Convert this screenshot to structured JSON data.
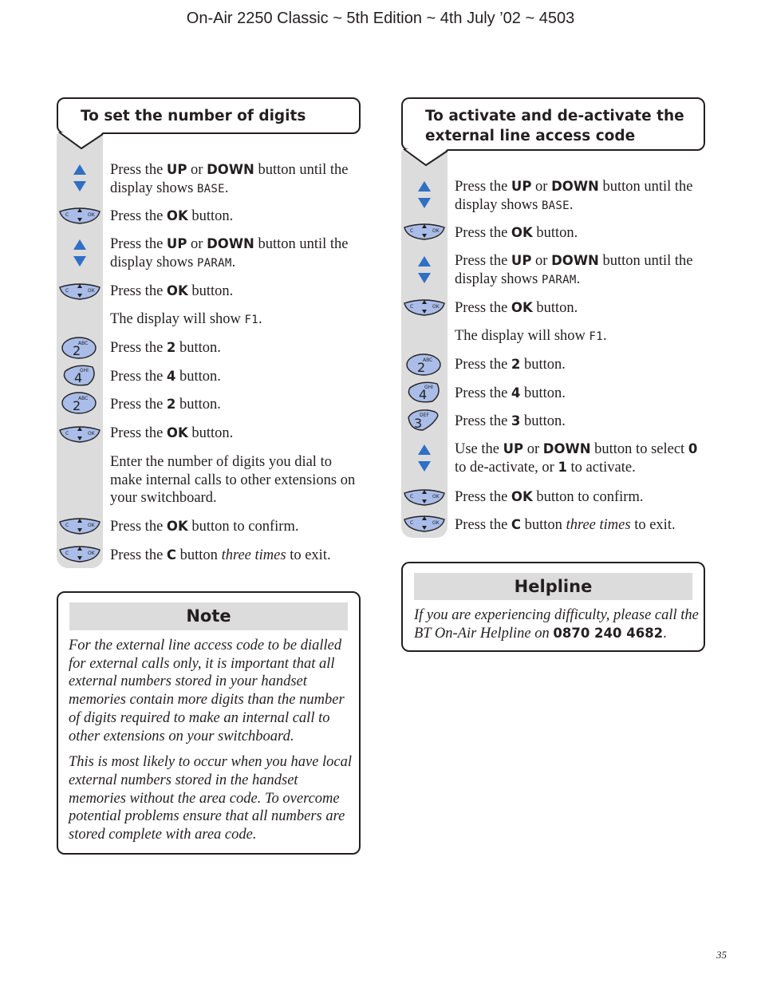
{
  "header": {
    "title": "On-Air 2250 Classic ~ 5th Edition ~ 4th July ’02 ~ 4503"
  },
  "page_number": "35",
  "left_section": {
    "title": "To set the number of digits",
    "steps": [
      {
        "icon": "up-down-arrows",
        "pre": "Press the ",
        "b1": "UP",
        "mid": " or ",
        "b2": "DOWN",
        "post": " button until the display shows ",
        "lcd": "BASE",
        "end": "."
      },
      {
        "icon": "ok-nav-key",
        "pre": "Press the ",
        "b1": "OK",
        "post": " button."
      },
      {
        "icon": "up-down-arrows",
        "pre": "Press the ",
        "b1": "UP",
        "mid": " or ",
        "b2": "DOWN",
        "post": " button until the display shows ",
        "lcd": "PARAM",
        "end": "."
      },
      {
        "icon": "ok-nav-key",
        "pre": "Press the ",
        "b1": "OK",
        "post": " button."
      },
      {
        "icon": "none",
        "pre": "The display will show ",
        "lcd": "F1",
        "end": "."
      },
      {
        "icon": "key-2",
        "key_digit": "2",
        "key_letters": "ABC",
        "pre": "Press the ",
        "b1": "2",
        "post": " button."
      },
      {
        "icon": "key-4",
        "key_digit": "4",
        "key_letters": "GHI",
        "pre": "Press the ",
        "b1": "4",
        "post": " button."
      },
      {
        "icon": "key-2",
        "key_digit": "2",
        "key_letters": "ABC",
        "pre": "Press the ",
        "b1": "2",
        "post": " button."
      },
      {
        "icon": "ok-nav-key",
        "pre": "Press the ",
        "b1": "OK",
        "post": " button."
      },
      {
        "icon": "none",
        "text": "Enter the number of digits you dial to make internal calls to other extensions on your switchboard."
      },
      {
        "icon": "ok-nav-key",
        "pre": "Press the ",
        "b1": "OK",
        "post": " button to confirm."
      },
      {
        "icon": "ok-nav-key",
        "pre": "Press the ",
        "b1": "C",
        "post": " button ",
        "italic": "three times",
        "end": " to exit."
      }
    ]
  },
  "right_section": {
    "title_line1": "To activate and de-activate the",
    "title_line2": "external line access code",
    "steps": [
      {
        "icon": "up-down-arrows",
        "pre": "Press the ",
        "b1": "UP",
        "mid": " or ",
        "b2": "DOWN",
        "post": " button until the display shows ",
        "lcd": "BASE",
        "end": "."
      },
      {
        "icon": "ok-nav-key",
        "pre": "Press the ",
        "b1": "OK",
        "post": " button."
      },
      {
        "icon": "up-down-arrows",
        "pre": "Press the ",
        "b1": "UP",
        "mid": " or ",
        "b2": "DOWN",
        "post": " button until the display shows ",
        "lcd": "PARAM",
        "end": "."
      },
      {
        "icon": "ok-nav-key",
        "pre": "Press the ",
        "b1": "OK",
        "post": " button."
      },
      {
        "icon": "none",
        "pre": "The display will show ",
        "lcd": "F1",
        "end": "."
      },
      {
        "icon": "key-2",
        "key_digit": "2",
        "key_letters": "ABC",
        "pre": "Press the ",
        "b1": "2",
        "post": " button."
      },
      {
        "icon": "key-4",
        "key_digit": "4",
        "key_letters": "GHI",
        "pre": "Press the ",
        "b1": "4",
        "post": " button."
      },
      {
        "icon": "key-3",
        "key_digit": "3",
        "key_letters": "DEF",
        "pre": "Press the ",
        "b1": "3",
        "post": " button."
      },
      {
        "icon": "up-down-arrows",
        "pre": "Use the ",
        "b1": "UP",
        "mid": " or ",
        "b2": "DOWN",
        "post": " button to select ",
        "b3": "0",
        "post2": " to de-activate, or ",
        "b4": "1",
        "end": " to activate."
      },
      {
        "icon": "ok-nav-key",
        "pre": "Press the ",
        "b1": "OK",
        "post": " button to confirm."
      },
      {
        "icon": "ok-nav-key",
        "pre": "Press the ",
        "b1": "C",
        "post": " button ",
        "italic": "three times",
        "end": " to exit."
      }
    ]
  },
  "note": {
    "heading": "Note",
    "paragraph1": "For the external line access code to be dialled for external calls only, it is important that all external numbers stored in your handset memories contain more digits than the number of digits required to make an internal call to other extensions on your switchboard.",
    "paragraph2": "This is most likely to occur when you have local external numbers stored in the handset memories without the area code. To overcome potential problems ensure that all numbers are stored complete with area code."
  },
  "helpline": {
    "heading": "Helpline",
    "text": "If you are experiencing difficulty, please call the BT On-Air Helpline on ",
    "phone": "0870 240 4682",
    "end": "."
  },
  "icon_labels": {
    "c": "C",
    "ok": "OK"
  },
  "colors": {
    "icon_blue": "#2f6fc4",
    "key_fill": "#a9bde8",
    "strip_gray": "#dcdcdc",
    "ink": "#231f20"
  }
}
